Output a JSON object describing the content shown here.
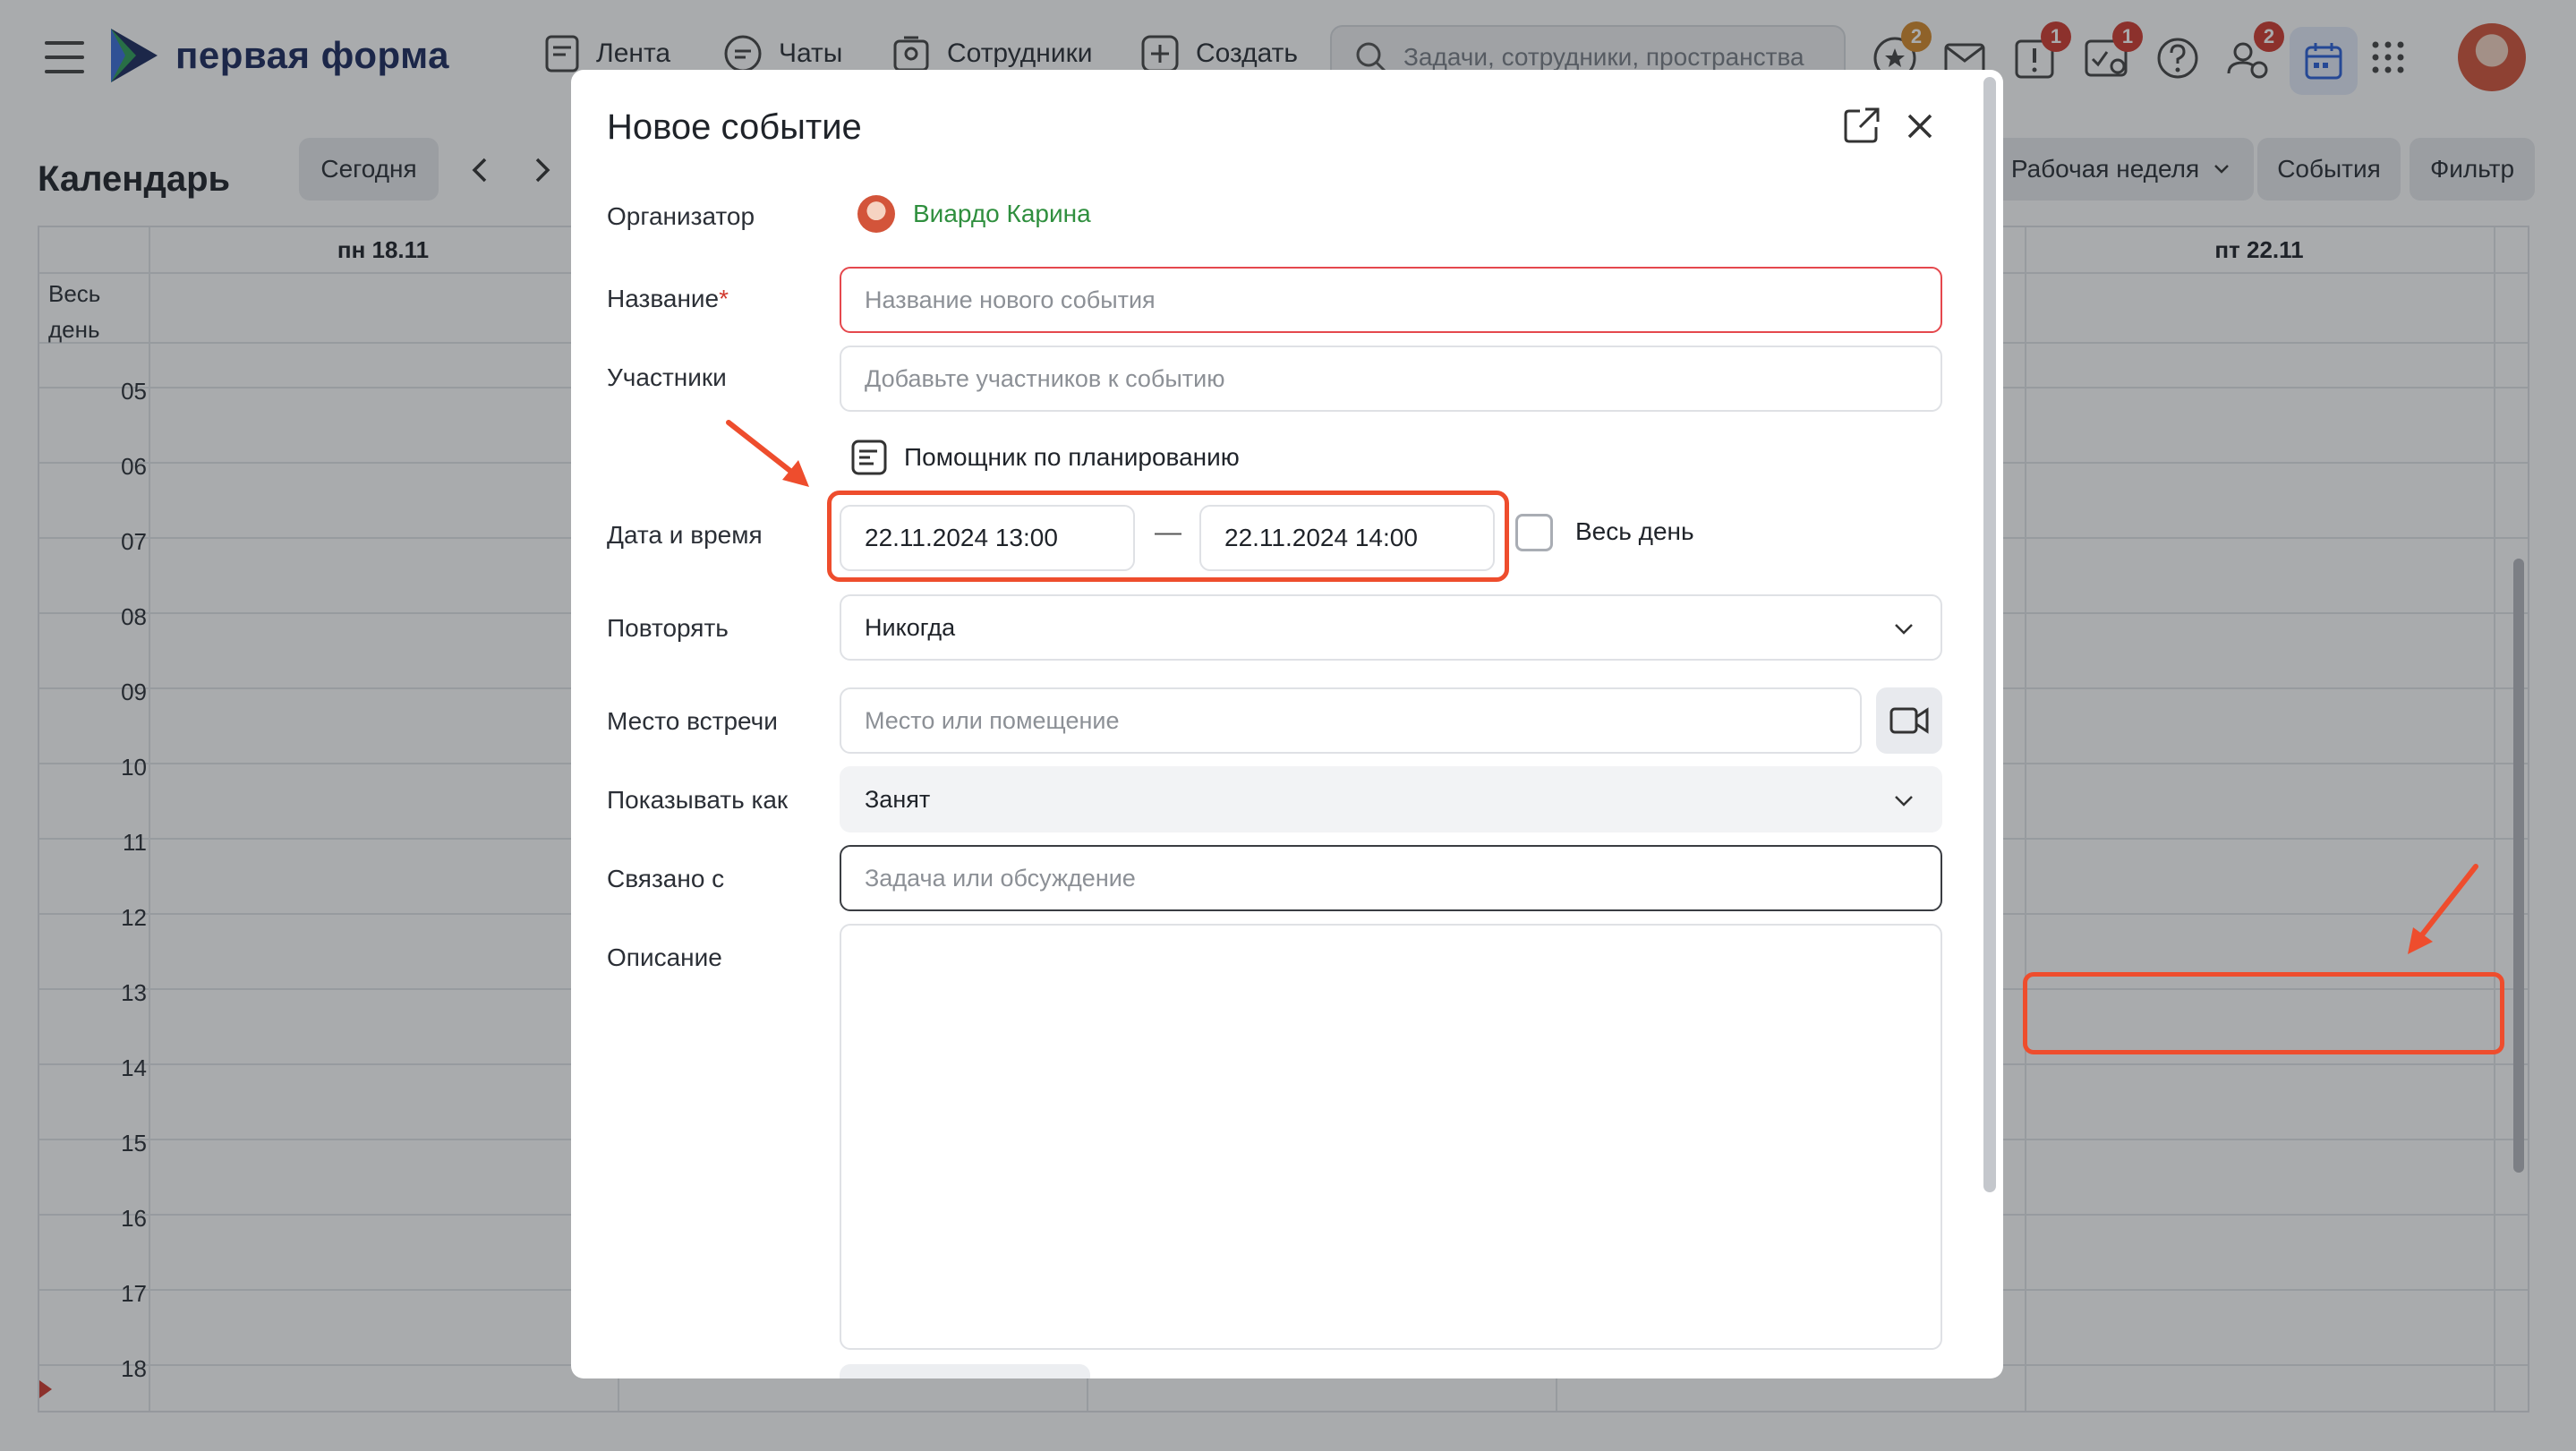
{
  "topbar": {
    "logo_text": "первая форма",
    "nav": [
      {
        "label": "Лента",
        "icon": "feed-icon"
      },
      {
        "label": "Чаты",
        "icon": "chat-icon"
      },
      {
        "label": "Сотрудники",
        "icon": "employees-icon"
      },
      {
        "label": "Создать",
        "icon": "plus-icon"
      }
    ],
    "search_placeholder": "Задачи, сотрудники, пространства",
    "badges": {
      "favorites": "2",
      "alerts": "1",
      "tasks": "1",
      "people": "2"
    }
  },
  "calendar": {
    "title": "Календарь",
    "today_label": "Сегодня",
    "view_label": "Рабочая неделя",
    "events_label": "События",
    "filter_label": "Фильтр",
    "days": [
      "пн 18.11",
      "пт 22.11"
    ],
    "allday_label": "Весь день",
    "hours": [
      "05",
      "06",
      "07",
      "08",
      "09",
      "10",
      "11",
      "12",
      "13",
      "14",
      "15",
      "16",
      "17",
      "18"
    ]
  },
  "modal": {
    "title": "Новое событие",
    "organizer": {
      "label": "Организатор",
      "name": "Виардо Карина"
    },
    "name": {
      "label": "Название",
      "required_mark": "*",
      "placeholder": "Название нового события"
    },
    "participants": {
      "label": "Участники",
      "placeholder": "Добавьте участников к событию"
    },
    "helper_label": "Помощник по планированию",
    "datetime": {
      "label": "Дата и время",
      "start": "22.11.2024 13:00",
      "end": "22.11.2024 14:00",
      "separator": "—",
      "allday_label": "Весь день",
      "allday_checked": false
    },
    "repeat": {
      "label": "Повторять",
      "value": "Никогда"
    },
    "location": {
      "label": "Место встречи",
      "placeholder": "Место или помещение"
    },
    "show_as": {
      "label": "Показывать как",
      "value": "Занят"
    },
    "related": {
      "label": "Связано с",
      "placeholder": "Задача или обсуждение"
    },
    "description": {
      "label": "Описание"
    }
  },
  "colors": {
    "accent": "#ee4d2d",
    "organizer": "#2f8f3e",
    "error_border": "#e5484d",
    "badge": "#d13a2f"
  }
}
